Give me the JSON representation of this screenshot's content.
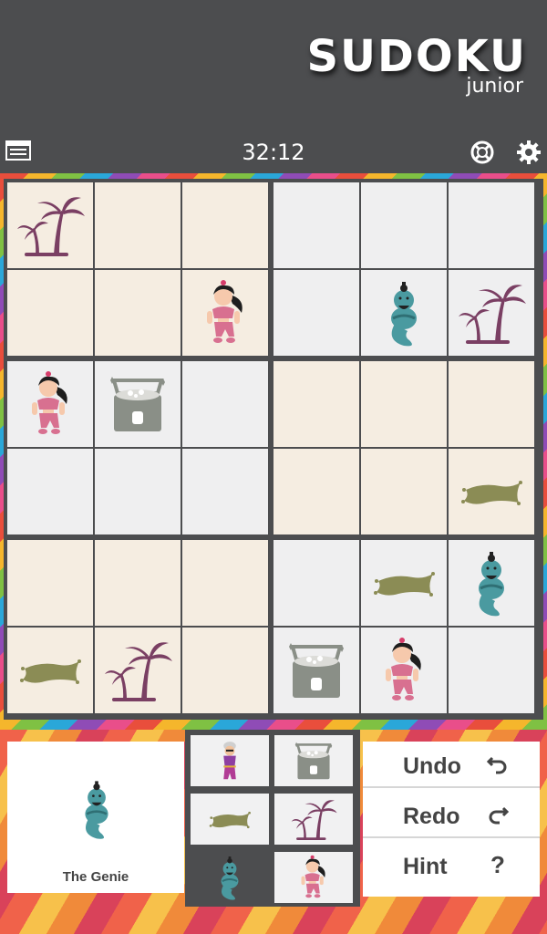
{
  "app": {
    "title": "SUDOKU",
    "subtitle": "junior"
  },
  "toolbar": {
    "menu_icon": "menu-icon",
    "timer": "32:12",
    "share_icon": "lifebuoy-icon",
    "settings_icon": "gear-icon"
  },
  "board": {
    "rows": 6,
    "cols": 6,
    "cells": [
      [
        "palm",
        "",
        "",
        "",
        "",
        ""
      ],
      [
        "",
        "",
        "princess",
        "",
        "genie",
        "palm"
      ],
      [
        "princess",
        "chest",
        "",
        "",
        "",
        ""
      ],
      [
        "",
        "",
        "",
        "",
        "",
        "carpet"
      ],
      [
        "",
        "",
        "",
        "",
        "carpet",
        "genie"
      ],
      [
        "carpet",
        "palm",
        "",
        "chest",
        "princess",
        ""
      ]
    ]
  },
  "selected": {
    "piece": "genie",
    "name": "The Genie"
  },
  "palette": [
    "aladdin",
    "chest",
    "carpet",
    "palm",
    "genie",
    "princess"
  ],
  "palette_active": "genie",
  "actions": {
    "undo_label": "Undo",
    "redo_label": "Redo",
    "hint_label": "Hint",
    "hint_symbol": "?"
  },
  "colors": {
    "palm": "#7a3f63",
    "carpet": "#8b8c55",
    "chest": "#8a8f87",
    "genie": "#4a9aa0",
    "princess": "#d87090",
    "beige_cell": "#f5ede1",
    "gray_cell": "#efeff0"
  }
}
